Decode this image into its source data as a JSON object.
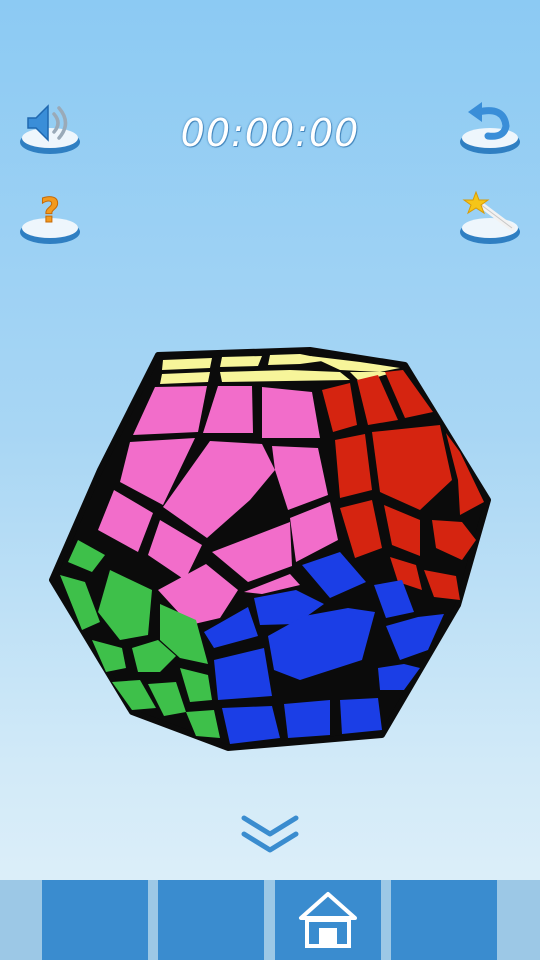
{
  "header": {
    "timer": "00:00:00",
    "sound_button": "speaker-icon",
    "help_button": "question-icon",
    "undo_button": "undo-arrow-icon",
    "solve_button": "magic-wand-icon"
  },
  "puzzle": {
    "type": "megaminx",
    "face_colors": {
      "top": "#f7f59a",
      "front": "#f26dca",
      "right": "#d52410",
      "bottom_front": "#1b3ee6",
      "left": "#3ec04a"
    }
  },
  "footer": {
    "expand_icon": "double-chevron-down-icon",
    "tabs": [
      "",
      "",
      "home",
      ""
    ],
    "home_icon": "home-icon"
  },
  "colors": {
    "accent": "#3a8ccf",
    "bar_background": "#9cc8e6",
    "timer_text": "#ffffff"
  }
}
